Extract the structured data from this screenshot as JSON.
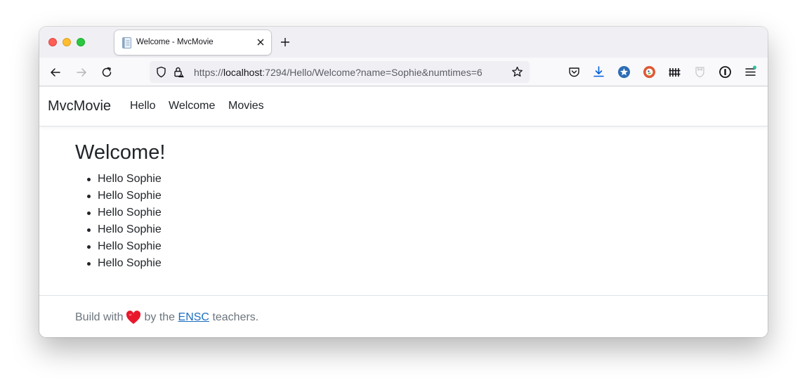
{
  "browser": {
    "tab": {
      "title": "Welcome - MvcMovie"
    },
    "url": {
      "protocol": "https://",
      "host": "localhost",
      "rest": ":7294/Hello/Welcome?name=Sophie&numtimes=6"
    }
  },
  "site": {
    "brand": "MvcMovie",
    "nav": [
      {
        "label": "Hello"
      },
      {
        "label": "Welcome"
      },
      {
        "label": "Movies"
      }
    ],
    "heading": "Welcome!",
    "greetings": [
      "Hello Sophie",
      "Hello Sophie",
      "Hello Sophie",
      "Hello Sophie",
      "Hello Sophie",
      "Hello Sophie"
    ],
    "footer": {
      "prefix": "Build with",
      "middle": "by the",
      "link": "ENSC",
      "suffix": "teachers."
    }
  },
  "colors": {
    "link": "#1b6ec2",
    "heart": "#e8182c",
    "text": "#212529",
    "muted": "#6c757d"
  },
  "icons": [
    "page-favicon",
    "close-icon",
    "plus-icon",
    "back-icon",
    "forward-icon",
    "reload-icon",
    "shield-icon",
    "lock-icon",
    "star-icon",
    "pocket-icon",
    "download-icon",
    "extension-star-icon",
    "duckduckgo-icon",
    "fence-icon",
    "ghost-shield-icon",
    "onepassword-icon",
    "menu-icon",
    "heart-icon"
  ]
}
